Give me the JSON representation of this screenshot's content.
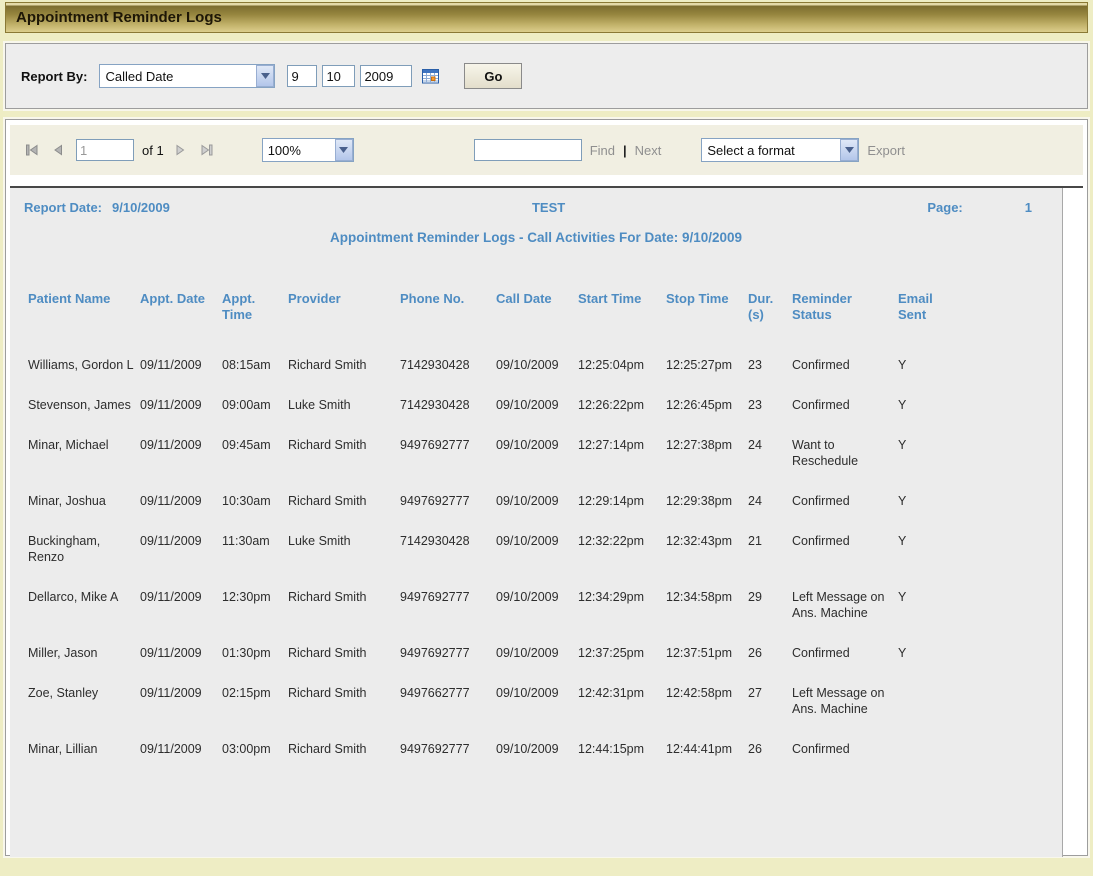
{
  "title_bar": {
    "title": "Appointment Reminder Logs"
  },
  "filter": {
    "label": "Report By:",
    "report_by_value": "Called Date",
    "month": "9",
    "day": "10",
    "year": "2009",
    "calendar_icon": "calendar-icon",
    "go_label": "Go"
  },
  "toolbar": {
    "page_number": "1",
    "of_label": "of 1",
    "zoom_value": "100%",
    "find_value": "",
    "find_label": "Find",
    "find_separator": "|",
    "next_label": "Next",
    "format_value": "Select a format",
    "export_label": "Export"
  },
  "report": {
    "report_date_label": "Report Date:",
    "report_date": "9/10/2009",
    "center_title": "TEST",
    "page_label": "Page:",
    "page_value": "1",
    "subtitle": "Appointment Reminder Logs - Call Activities For Date: 9/10/2009",
    "columns": [
      "Patient Name",
      "Appt. Date",
      "Appt. Time",
      "Provider",
      "Phone No.",
      "Call Date",
      "Start Time",
      "Stop Time",
      "Dur. (s)",
      "Reminder Status",
      "Email Sent"
    ],
    "rows": [
      [
        "Williams, Gordon L",
        "09/11/2009",
        "08:15am",
        "Richard Smith",
        "7142930428",
        "09/10/2009",
        "12:25:04pm",
        "12:25:27pm",
        "23",
        "Confirmed",
        "Y"
      ],
      [
        "Stevenson, James",
        "09/11/2009",
        "09:00am",
        "Luke Smith",
        "7142930428",
        "09/10/2009",
        "12:26:22pm",
        "12:26:45pm",
        "23",
        "Confirmed",
        "Y"
      ],
      [
        "Minar, Michael",
        "09/11/2009",
        "09:45am",
        "Richard Smith",
        "9497692777",
        "09/10/2009",
        "12:27:14pm",
        "12:27:38pm",
        "24",
        "Want to Reschedule",
        "Y"
      ],
      [
        "Minar, Joshua",
        "09/11/2009",
        "10:30am",
        "Richard Smith",
        "9497692777",
        "09/10/2009",
        "12:29:14pm",
        "12:29:38pm",
        "24",
        "Confirmed",
        "Y"
      ],
      [
        "Buckingham, Renzo",
        "09/11/2009",
        "11:30am",
        "Luke Smith",
        "7142930428",
        "09/10/2009",
        "12:32:22pm",
        "12:32:43pm",
        "21",
        "Confirmed",
        "Y"
      ],
      [
        "Dellarco, Mike A",
        "09/11/2009",
        "12:30pm",
        "Richard Smith",
        "9497692777",
        "09/10/2009",
        "12:34:29pm",
        "12:34:58pm",
        "29",
        "Left Message on Ans. Machine",
        "Y"
      ],
      [
        "Miller, Jason",
        "09/11/2009",
        "01:30pm",
        "Richard Smith",
        "9497692777",
        "09/10/2009",
        "12:37:25pm",
        "12:37:51pm",
        "26",
        "Confirmed",
        "Y"
      ],
      [
        "Zoe, Stanley",
        "09/11/2009",
        "02:15pm",
        "Richard Smith",
        "9497662777",
        "09/10/2009",
        "12:42:31pm",
        "12:42:58pm",
        "27",
        "Left Message on Ans. Machine",
        ""
      ],
      [
        "Minar, Lillian",
        "09/11/2009",
        "03:00pm",
        "Richard Smith",
        "9497692777",
        "09/10/2009",
        "12:44:15pm",
        "12:44:41pm",
        "26",
        "Confirmed",
        ""
      ]
    ]
  },
  "colors": {
    "report_accent_blue": "#4e8cc2",
    "title_gold_dark": "#8a7935",
    "title_gold_light": "#dcce8c",
    "toolbar_cream": "#f1efe2",
    "page_background": "#eeedc4",
    "report_gray": "#ececec"
  }
}
